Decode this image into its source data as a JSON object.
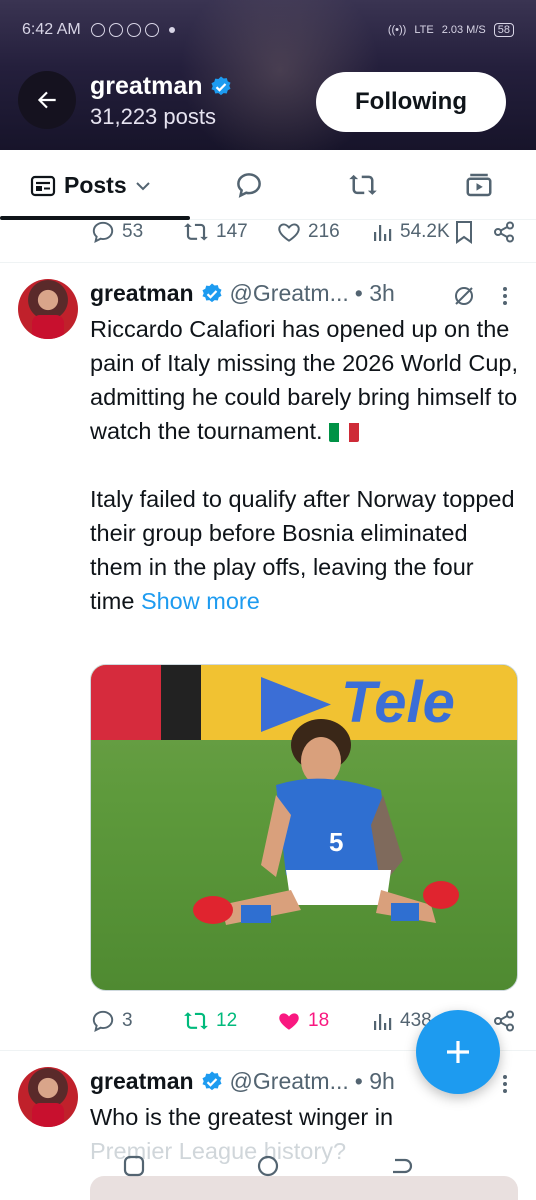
{
  "status_bar": {
    "time": "6:42 AM",
    "net": "LTE",
    "speed": "2.03 M/S",
    "battery": "58"
  },
  "header": {
    "name": "greatman",
    "posts": "31,223 posts",
    "follow_label": "Following"
  },
  "tabs": {
    "posts_label": "Posts"
  },
  "top_actions": {
    "replies": "53",
    "reposts": "147",
    "likes": "216",
    "views": "54.2K"
  },
  "tweet1": {
    "name": "greatman",
    "handle": "@Greatm...",
    "time": "• 3h",
    "para1": "Riccardo Calafiori has opened up on the pain of Italy missing the 2026 World Cup, admitting he could barely bring himself to watch the tournament.",
    "para2": "Italy failed to qualify after Norway topped their group before Bosnia eliminated them in the play offs, leaving the four time",
    "show_more": "Show more",
    "media_sign_text": "Tele",
    "jersey_number": "5",
    "replies": "3",
    "reposts": "12",
    "likes": "18",
    "views": "438"
  },
  "tweet2": {
    "name": "greatman",
    "handle": "@Greatm...",
    "time": "• 9h",
    "line1": "Who is the greatest winger in",
    "line2": "Premier League history?"
  },
  "colors": {
    "accent": "#1d9bf0",
    "like": "#f91880",
    "repost": "#00ba7c",
    "muted": "#536471"
  }
}
